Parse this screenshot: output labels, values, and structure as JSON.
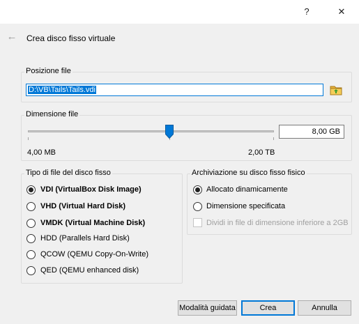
{
  "window": {
    "help_label": "?",
    "close_label": "✕"
  },
  "wizard": {
    "back_icon": "left-arrow-icon",
    "title": "Crea disco fisso virtuale"
  },
  "file_location": {
    "group_title": "Posizione file",
    "path_value": "D:\\VB\\Tails\\Tails.vdi",
    "browse_icon": "folder-icon"
  },
  "file_size": {
    "group_title": "Dimensione file",
    "value": "8,00 GB",
    "min_label": "4,00 MB",
    "max_label": "2,00 TB",
    "slider_fraction": 0.578
  },
  "disk_type": {
    "group_title": "Tipo di file del disco fisso",
    "options": [
      {
        "label": "VDI (VirtualBox Disk Image)",
        "selected": true,
        "bold": true
      },
      {
        "label": "VHD (Virtual Hard Disk)",
        "selected": false,
        "bold": true
      },
      {
        "label": "VMDK (Virtual Machine Disk)",
        "selected": false,
        "bold": true
      },
      {
        "label": "HDD (Parallels Hard Disk)",
        "selected": false,
        "bold": false
      },
      {
        "label": "QCOW (QEMU Copy-On-Write)",
        "selected": false,
        "bold": false
      },
      {
        "label": "QED (QEMU enhanced disk)",
        "selected": false,
        "bold": false
      }
    ]
  },
  "storage": {
    "group_title": "Archiviazione su disco fisso fisico",
    "options": [
      {
        "label": "Allocato dinamicamente",
        "selected": true
      },
      {
        "label": "Dimensione specificata",
        "selected": false
      }
    ],
    "split_label": "Dividi in file di dimensione inferiore a 2GB",
    "split_checked": false,
    "split_enabled": false
  },
  "buttons": {
    "guided_label": "Modalità guidata",
    "create_label": "Crea",
    "cancel_label": "Annulla"
  },
  "colors": {
    "accent": "#0078d7",
    "background": "#f0f0f0"
  }
}
